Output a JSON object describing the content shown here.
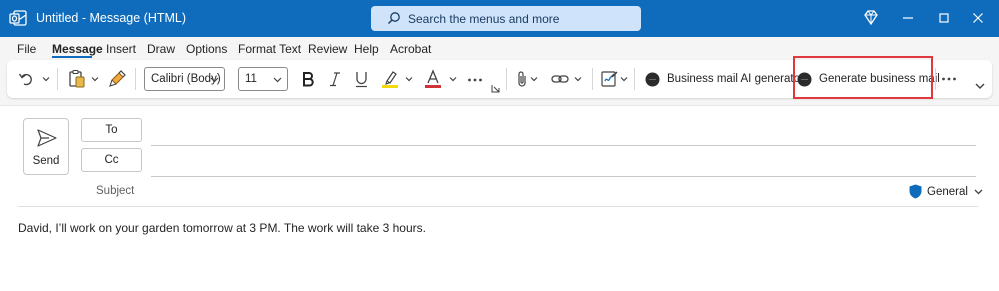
{
  "window": {
    "title": "Untitled  -  Message (HTML)",
    "search_placeholder": "Search the menus and more"
  },
  "colors": {
    "titlebar": "#0f6cbd",
    "highlight": "#e0383e",
    "accent_yellow": "#f5d90a",
    "accent_red": "#d13438"
  },
  "menu": {
    "tabs": [
      "File",
      "Message",
      "Insert",
      "Draw",
      "Options",
      "Format Text",
      "Review",
      "Help",
      "Acrobat"
    ],
    "active": "Message"
  },
  "ribbon": {
    "font_name": "Calibri (Body)",
    "font_size": "11",
    "ai_generator_label": "Business mail AI generator",
    "generate_label": "Generate business mail"
  },
  "compose": {
    "send_label": "Send",
    "to_label": "To",
    "cc_label": "Cc",
    "subject_label": "Subject",
    "sensitivity_label": "General",
    "body": "David, I’ll work on your garden tomorrow at 3 PM. The work will take 3 hours."
  }
}
